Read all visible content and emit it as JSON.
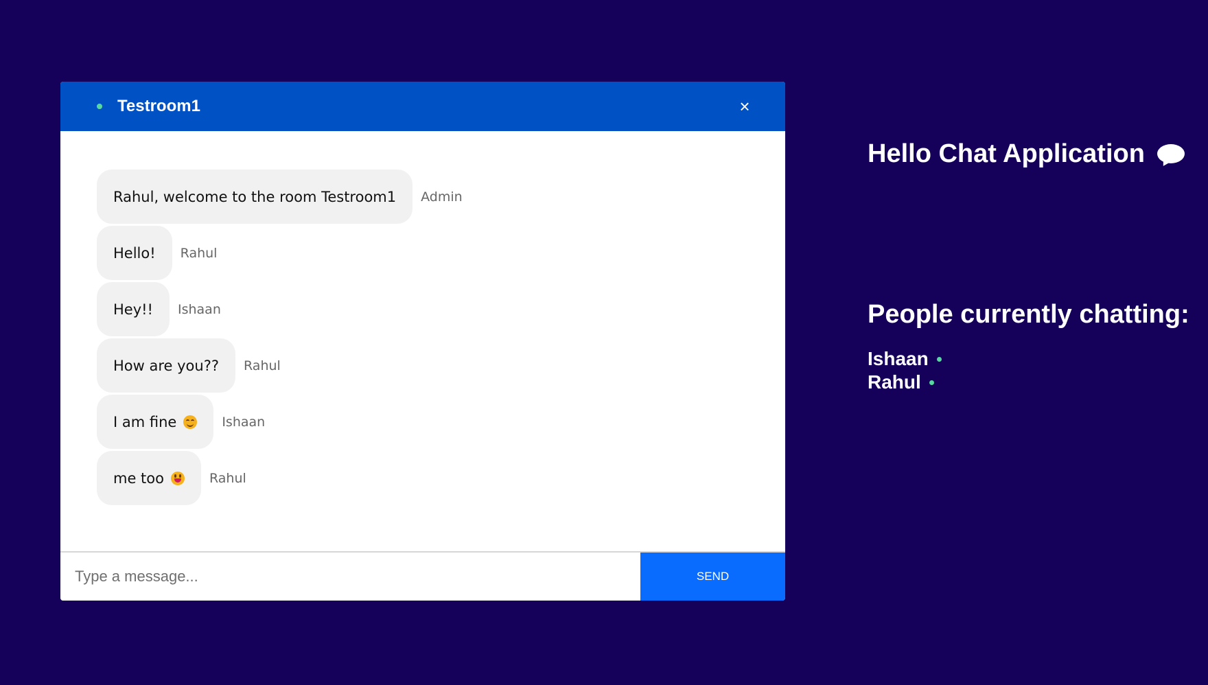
{
  "room": {
    "title": "Testroom1",
    "close_label": "×"
  },
  "messages": [
    {
      "text": "Rahul, welcome to the room Testroom1",
      "sender": "Admin"
    },
    {
      "text": "Hello!",
      "sender": "Rahul"
    },
    {
      "text": "Hey!!",
      "sender": "Ishaan"
    },
    {
      "text": "How are you??",
      "sender": "Rahul"
    },
    {
      "text": "I am fine",
      "sender": "Ishaan",
      "emoji": "smiling-face-icon"
    },
    {
      "text": "me too",
      "sender": "Rahul",
      "emoji": "grinning-face-icon"
    }
  ],
  "composer": {
    "placeholder": "Type a message...",
    "value": "",
    "send_label": "SEND"
  },
  "sidebar": {
    "app_title": "Hello Chat Application",
    "app_icon": "speech-bubble-icon",
    "people_title": "People currently chatting:",
    "people": [
      "Ishaan",
      "Rahul"
    ]
  },
  "colors": {
    "background": "#15005a",
    "header": "#0052c4",
    "send_button": "#0a6cff",
    "online": "#57d8a0",
    "bubble": "#f1f1f1"
  }
}
